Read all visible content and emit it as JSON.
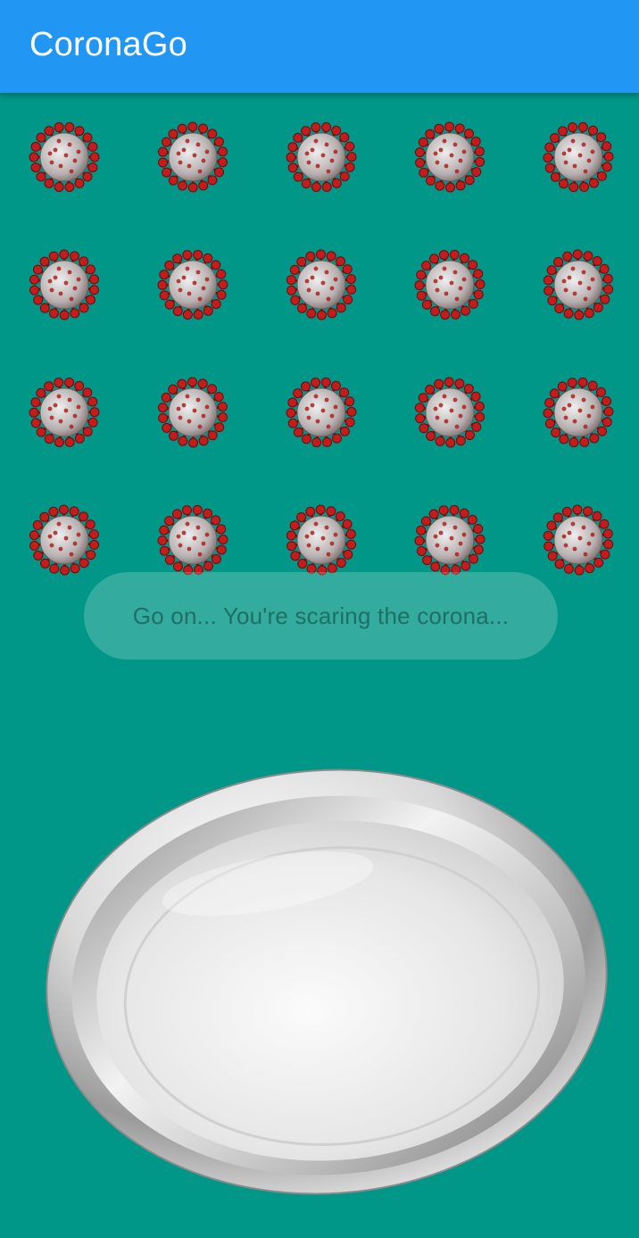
{
  "app_bar": {
    "title": "CoronaGo",
    "color": "#2196F3"
  },
  "background_color": "#009688",
  "virus_grid": {
    "rows": 4,
    "columns": 5,
    "icon": "coronavirus-icon"
  },
  "toast": {
    "message": "Go on... You're scaring the corona..."
  },
  "plate": {
    "icon": "steel-plate-icon"
  }
}
